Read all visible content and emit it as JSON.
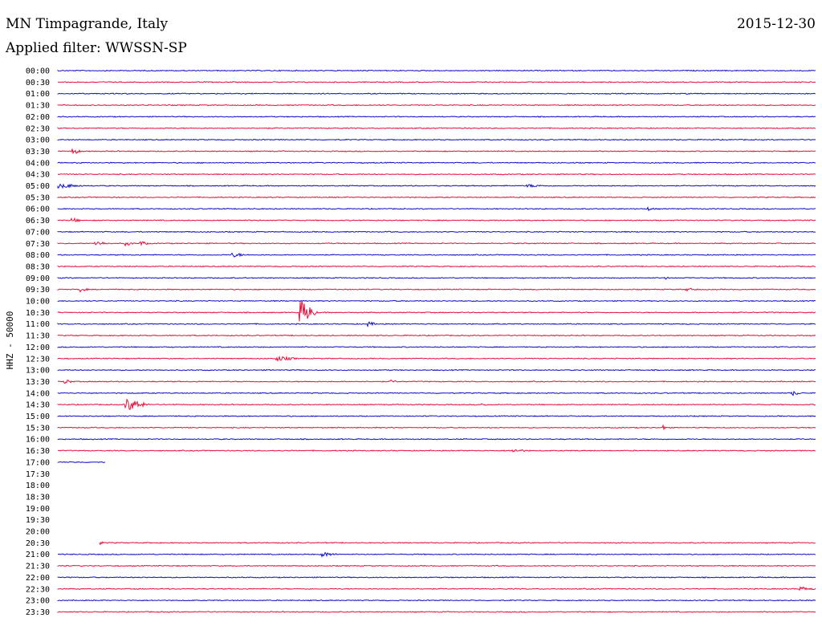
{
  "header": {
    "title": "MN Timpagrande, Italy",
    "date": "2015-12-30",
    "filter": "Applied filter: WWSSN-SP"
  },
  "colors": {
    "even": "#1010c8",
    "odd": "#e8103c"
  },
  "chart_data": {
    "type": "line",
    "title": "MN Timpagrande, Italy",
    "ylabel": "HHZ - 50000",
    "xlabel": "",
    "rows": [
      {
        "label": "00:00",
        "color": "even",
        "span": [
          0,
          1
        ],
        "events": []
      },
      {
        "label": "00:30",
        "color": "odd",
        "span": [
          0,
          1
        ],
        "events": []
      },
      {
        "label": "01:00",
        "color": "even",
        "span": [
          0,
          1
        ],
        "events": []
      },
      {
        "label": "01:30",
        "color": "odd",
        "span": [
          0,
          1
        ],
        "events": []
      },
      {
        "label": "02:00",
        "color": "even",
        "span": [
          0,
          1
        ],
        "events": []
      },
      {
        "label": "02:30",
        "color": "odd",
        "span": [
          0,
          1
        ],
        "events": []
      },
      {
        "label": "03:00",
        "color": "even",
        "span": [
          0,
          1
        ],
        "events": []
      },
      {
        "label": "03:30",
        "color": "odd",
        "span": [
          0,
          1
        ],
        "events": [
          {
            "t": 0.02,
            "amp": 4,
            "dur": 0.01
          }
        ]
      },
      {
        "label": "04:00",
        "color": "even",
        "span": [
          0,
          1
        ],
        "events": []
      },
      {
        "label": "04:30",
        "color": "odd",
        "span": [
          0,
          1
        ],
        "events": []
      },
      {
        "label": "05:00",
        "color": "even",
        "span": [
          0,
          1
        ],
        "events": [
          {
            "t": 0.0,
            "amp": 3,
            "dur": 0.04
          },
          {
            "t": 0.62,
            "amp": 2,
            "dur": 0.03
          }
        ]
      },
      {
        "label": "05:30",
        "color": "odd",
        "span": [
          0,
          1
        ],
        "events": []
      },
      {
        "label": "06:00",
        "color": "even",
        "span": [
          0,
          1
        ],
        "events": [
          {
            "t": 0.78,
            "amp": 2,
            "dur": 0.01
          }
        ]
      },
      {
        "label": "06:30",
        "color": "odd",
        "span": [
          0,
          1
        ],
        "events": [
          {
            "t": 0.02,
            "amp": 3,
            "dur": 0.01
          }
        ]
      },
      {
        "label": "07:00",
        "color": "even",
        "span": [
          0,
          1
        ],
        "events": []
      },
      {
        "label": "07:30",
        "color": "odd",
        "span": [
          0,
          1
        ],
        "events": [
          {
            "t": 0.05,
            "amp": 3,
            "dur": 0.02
          },
          {
            "t": 0.09,
            "amp": 3,
            "dur": 0.01
          },
          {
            "t": 0.11,
            "amp": 3,
            "dur": 0.01
          }
        ]
      },
      {
        "label": "08:00",
        "color": "even",
        "span": [
          0,
          1
        ],
        "events": [
          {
            "t": 0.23,
            "amp": 3,
            "dur": 0.02
          }
        ]
      },
      {
        "label": "08:30",
        "color": "odd",
        "span": [
          0,
          1
        ],
        "events": []
      },
      {
        "label": "09:00",
        "color": "even",
        "span": [
          0,
          1
        ],
        "events": [
          {
            "t": 0.8,
            "amp": 2,
            "dur": 0.01
          }
        ]
      },
      {
        "label": "09:30",
        "color": "odd",
        "span": [
          0,
          1
        ],
        "events": [
          {
            "t": 0.03,
            "amp": 3,
            "dur": 0.01
          },
          {
            "t": 0.83,
            "amp": 2,
            "dur": 0.02
          }
        ]
      },
      {
        "label": "10:00",
        "color": "even",
        "span": [
          0,
          1
        ],
        "events": []
      },
      {
        "label": "10:30",
        "color": "odd",
        "span": [
          0,
          1
        ],
        "events": [
          {
            "t": 0.32,
            "amp": 16,
            "dur": 0.02
          }
        ]
      },
      {
        "label": "11:00",
        "color": "even",
        "span": [
          0,
          1
        ],
        "events": [
          {
            "t": 0.41,
            "amp": 3,
            "dur": 0.01
          }
        ]
      },
      {
        "label": "11:30",
        "color": "odd",
        "span": [
          0,
          1
        ],
        "events": []
      },
      {
        "label": "12:00",
        "color": "even",
        "span": [
          0,
          1
        ],
        "events": []
      },
      {
        "label": "12:30",
        "color": "odd",
        "span": [
          0,
          1
        ],
        "events": [
          {
            "t": 0.29,
            "amp": 3,
            "dur": 0.03
          }
        ]
      },
      {
        "label": "13:00",
        "color": "even",
        "span": [
          0,
          1
        ],
        "events": []
      },
      {
        "label": "13:30",
        "color": "odd",
        "span": [
          0,
          1
        ],
        "events": [
          {
            "t": 0.01,
            "amp": 3,
            "dur": 0.01
          },
          {
            "t": 0.44,
            "amp": 2,
            "dur": 0.01
          }
        ]
      },
      {
        "label": "14:00",
        "color": "even",
        "span": [
          0,
          1
        ],
        "events": [
          {
            "t": 0.97,
            "amp": 3,
            "dur": 0.01
          }
        ]
      },
      {
        "label": "14:30",
        "color": "odd",
        "span": [
          0,
          1
        ],
        "events": [
          {
            "t": 0.09,
            "amp": 8,
            "dur": 0.03
          },
          {
            "t": 0.56,
            "amp": 2,
            "dur": 0.01
          }
        ]
      },
      {
        "label": "15:00",
        "color": "even",
        "span": [
          0,
          1
        ],
        "events": []
      },
      {
        "label": "15:30",
        "color": "odd",
        "span": [
          0,
          1
        ],
        "events": [
          {
            "t": 0.8,
            "amp": 3,
            "dur": 0.005
          }
        ]
      },
      {
        "label": "16:00",
        "color": "even",
        "span": [
          0,
          1
        ],
        "events": []
      },
      {
        "label": "16:30",
        "color": "odd",
        "span": [
          0,
          1
        ],
        "events": [
          {
            "t": 0.6,
            "amp": 2,
            "dur": 0.03
          }
        ]
      },
      {
        "label": "17:00",
        "color": "even",
        "span": [
          0,
          0.063
        ],
        "events": []
      },
      {
        "label": "17:30",
        "color": "odd",
        "span": null,
        "events": []
      },
      {
        "label": "18:00",
        "color": "even",
        "span": null,
        "events": []
      },
      {
        "label": "18:30",
        "color": "odd",
        "span": null,
        "events": []
      },
      {
        "label": "19:00",
        "color": "even",
        "span": null,
        "events": []
      },
      {
        "label": "19:30",
        "color": "odd",
        "span": null,
        "events": []
      },
      {
        "label": "20:00",
        "color": "even",
        "span": null,
        "events": []
      },
      {
        "label": "20:30",
        "color": "odd",
        "span": [
          0.055,
          1
        ],
        "events": [
          {
            "t": 0.055,
            "amp": 4,
            "dur": 0.002
          }
        ]
      },
      {
        "label": "21:00",
        "color": "even",
        "span": [
          0,
          1
        ],
        "events": [
          {
            "t": 0.35,
            "amp": 3,
            "dur": 0.02
          }
        ]
      },
      {
        "label": "21:30",
        "color": "odd",
        "span": [
          0,
          1
        ],
        "events": []
      },
      {
        "label": "22:00",
        "color": "even",
        "span": [
          0,
          1
        ],
        "events": []
      },
      {
        "label": "22:30",
        "color": "odd",
        "span": [
          0,
          1
        ],
        "events": [
          {
            "t": 0.98,
            "amp": 3,
            "dur": 0.02
          }
        ]
      },
      {
        "label": "23:00",
        "color": "even",
        "span": [
          0,
          1
        ],
        "events": []
      },
      {
        "label": "23:30",
        "color": "odd",
        "span": [
          0,
          1
        ],
        "events": []
      }
    ]
  }
}
